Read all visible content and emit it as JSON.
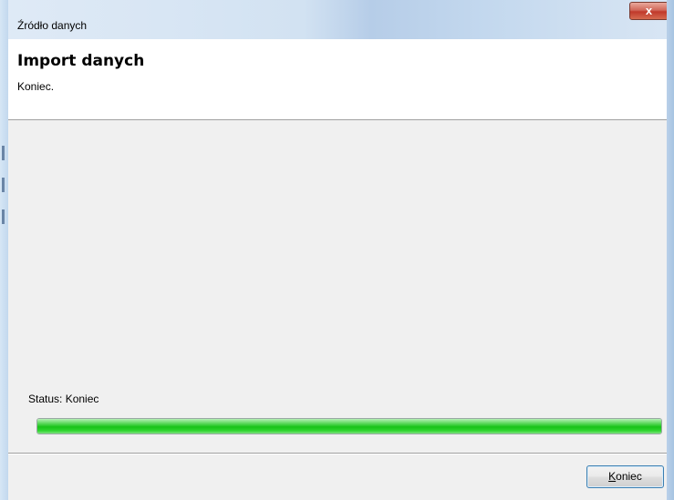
{
  "window": {
    "title": "Źródło danych",
    "close_label": "x"
  },
  "header": {
    "title": "Import danych",
    "subtitle": "Koniec."
  },
  "status": {
    "label": "Status:  Koniec",
    "progress_percent": 100,
    "progress_color": "#18c218"
  },
  "footer": {
    "finish_button": {
      "mnemonic": "K",
      "rest": "oniec"
    }
  }
}
